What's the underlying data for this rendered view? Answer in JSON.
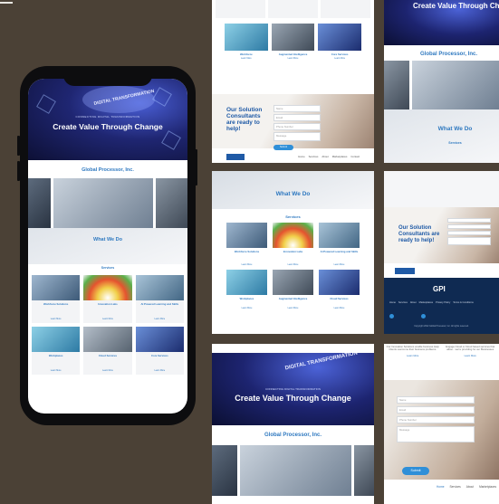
{
  "phone": {
    "hero_kicker": "CONNECTING DIGITAL TRANSFORMATION",
    "hero_tag": "DIGITAL TRANSFORMATION",
    "hero_title": "Create Value Through Change",
    "company_heading": "Global Processor, Inc.",
    "what_we_do": "What We Do",
    "services": "Services",
    "cards": [
      {
        "title": "Workforce Solutions",
        "link": "Learn More"
      },
      {
        "title": "Innovation Labs",
        "link": "Learn More"
      },
      {
        "title": "AI Powered Learning and Skills",
        "link": "Learn More"
      },
      {
        "title": "Workplaces",
        "link": "Learn More"
      },
      {
        "title": "Cloud Services",
        "link": "Learn More"
      },
      {
        "title": "Core Services",
        "link": "Learn More"
      }
    ]
  },
  "panel_a": {
    "consultants_heading": "Our Solution Consultants are ready to help!",
    "form_fields": [
      "Name",
      "Email",
      "Phone Number",
      "Message"
    ],
    "submit": "Submit",
    "footer_nav": [
      "Home",
      "Services",
      "About",
      "Marketplaces",
      "Contact"
    ],
    "cards": [
      {
        "title": "Workforce",
        "link": "Learn More"
      },
      {
        "title": "Augmented Intelligence",
        "link": "Learn More"
      },
      {
        "title": "Core Services",
        "link": "Learn More"
      }
    ]
  },
  "panel_b": {
    "hero_title": "Create Value Through Ch",
    "company_heading": "Global Processor, Inc.",
    "what_we_do": "What We Do",
    "services": "Services"
  },
  "panel_c": {
    "what_we_do": "What We Do",
    "services": "Services",
    "cards": [
      {
        "title": "Workforce Solutions",
        "link": "Learn More"
      },
      {
        "title": "Innovation Labs",
        "link": "Learn More"
      },
      {
        "title": "AI Powered Learning and Skills",
        "link": "Learn More"
      },
      {
        "title": "Workplaces",
        "link": "Learn More"
      },
      {
        "title": "Augmented Intelligence",
        "link": "Learn More"
      },
      {
        "title": "Cloud Services",
        "link": "Learn More"
      }
    ]
  },
  "panel_d": {
    "consultants_heading": "Our Solution Consultants are ready to help!",
    "logo": "GPI",
    "footer_links": [
      "Home",
      "Services",
      "About",
      "Marketplaces",
      "Privacy Policy",
      "Terms & Conditions"
    ],
    "copyright": "Copyright 2022 Global Processor, Inc. All rights reserved."
  },
  "panel_e": {
    "hero_kicker": "CONNECTING DIGITAL TRANSFORMATION",
    "hero_tag": "DIGITAL TRANSFORMATION",
    "hero_title": "Create Value Through Change",
    "company_heading": "Global Processor, Inc."
  },
  "panel_f": {
    "blurb_left": "Our Innovation Solutions enable business Help Clients overcome their business problems.",
    "blurb_right": "Engage Cloud or Cloud based services that allow... we're providing for our Businesses",
    "link_left": "Learn More",
    "link_right": "Learn More",
    "form_fields": [
      "Name",
      "Email",
      "Phone Number",
      "Message"
    ],
    "submit": "Submit",
    "nav": [
      "Home",
      "Services",
      "About",
      "Marketplaces"
    ]
  },
  "colors": {
    "accent": "#2f79c0",
    "hero_dark": "#1d2470",
    "footer_navy": "#0f2a52",
    "backdrop": "#4b4136"
  }
}
